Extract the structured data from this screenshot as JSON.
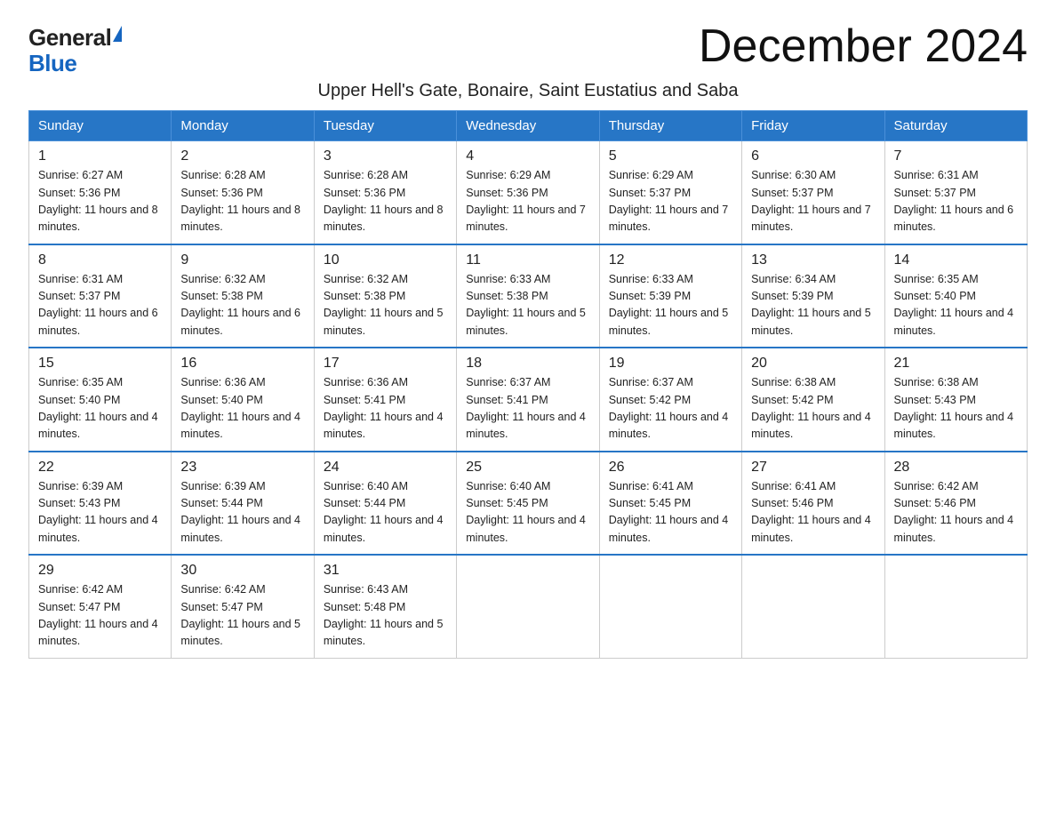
{
  "header": {
    "logo_general": "General",
    "logo_blue": "Blue",
    "month_title": "December 2024",
    "location": "Upper Hell's Gate, Bonaire, Saint Eustatius and Saba"
  },
  "days_of_week": [
    "Sunday",
    "Monday",
    "Tuesday",
    "Wednesday",
    "Thursday",
    "Friday",
    "Saturday"
  ],
  "weeks": [
    [
      {
        "day": "1",
        "sunrise": "6:27 AM",
        "sunset": "5:36 PM",
        "daylight": "11 hours and 8 minutes."
      },
      {
        "day": "2",
        "sunrise": "6:28 AM",
        "sunset": "5:36 PM",
        "daylight": "11 hours and 8 minutes."
      },
      {
        "day": "3",
        "sunrise": "6:28 AM",
        "sunset": "5:36 PM",
        "daylight": "11 hours and 8 minutes."
      },
      {
        "day": "4",
        "sunrise": "6:29 AM",
        "sunset": "5:36 PM",
        "daylight": "11 hours and 7 minutes."
      },
      {
        "day": "5",
        "sunrise": "6:29 AM",
        "sunset": "5:37 PM",
        "daylight": "11 hours and 7 minutes."
      },
      {
        "day": "6",
        "sunrise": "6:30 AM",
        "sunset": "5:37 PM",
        "daylight": "11 hours and 7 minutes."
      },
      {
        "day": "7",
        "sunrise": "6:31 AM",
        "sunset": "5:37 PM",
        "daylight": "11 hours and 6 minutes."
      }
    ],
    [
      {
        "day": "8",
        "sunrise": "6:31 AM",
        "sunset": "5:37 PM",
        "daylight": "11 hours and 6 minutes."
      },
      {
        "day": "9",
        "sunrise": "6:32 AM",
        "sunset": "5:38 PM",
        "daylight": "11 hours and 6 minutes."
      },
      {
        "day": "10",
        "sunrise": "6:32 AM",
        "sunset": "5:38 PM",
        "daylight": "11 hours and 5 minutes."
      },
      {
        "day": "11",
        "sunrise": "6:33 AM",
        "sunset": "5:38 PM",
        "daylight": "11 hours and 5 minutes."
      },
      {
        "day": "12",
        "sunrise": "6:33 AM",
        "sunset": "5:39 PM",
        "daylight": "11 hours and 5 minutes."
      },
      {
        "day": "13",
        "sunrise": "6:34 AM",
        "sunset": "5:39 PM",
        "daylight": "11 hours and 5 minutes."
      },
      {
        "day": "14",
        "sunrise": "6:35 AM",
        "sunset": "5:40 PM",
        "daylight": "11 hours and 4 minutes."
      }
    ],
    [
      {
        "day": "15",
        "sunrise": "6:35 AM",
        "sunset": "5:40 PM",
        "daylight": "11 hours and 4 minutes."
      },
      {
        "day": "16",
        "sunrise": "6:36 AM",
        "sunset": "5:40 PM",
        "daylight": "11 hours and 4 minutes."
      },
      {
        "day": "17",
        "sunrise": "6:36 AM",
        "sunset": "5:41 PM",
        "daylight": "11 hours and 4 minutes."
      },
      {
        "day": "18",
        "sunrise": "6:37 AM",
        "sunset": "5:41 PM",
        "daylight": "11 hours and 4 minutes."
      },
      {
        "day": "19",
        "sunrise": "6:37 AM",
        "sunset": "5:42 PM",
        "daylight": "11 hours and 4 minutes."
      },
      {
        "day": "20",
        "sunrise": "6:38 AM",
        "sunset": "5:42 PM",
        "daylight": "11 hours and 4 minutes."
      },
      {
        "day": "21",
        "sunrise": "6:38 AM",
        "sunset": "5:43 PM",
        "daylight": "11 hours and 4 minutes."
      }
    ],
    [
      {
        "day": "22",
        "sunrise": "6:39 AM",
        "sunset": "5:43 PM",
        "daylight": "11 hours and 4 minutes."
      },
      {
        "day": "23",
        "sunrise": "6:39 AM",
        "sunset": "5:44 PM",
        "daylight": "11 hours and 4 minutes."
      },
      {
        "day": "24",
        "sunrise": "6:40 AM",
        "sunset": "5:44 PM",
        "daylight": "11 hours and 4 minutes."
      },
      {
        "day": "25",
        "sunrise": "6:40 AM",
        "sunset": "5:45 PM",
        "daylight": "11 hours and 4 minutes."
      },
      {
        "day": "26",
        "sunrise": "6:41 AM",
        "sunset": "5:45 PM",
        "daylight": "11 hours and 4 minutes."
      },
      {
        "day": "27",
        "sunrise": "6:41 AM",
        "sunset": "5:46 PM",
        "daylight": "11 hours and 4 minutes."
      },
      {
        "day": "28",
        "sunrise": "6:42 AM",
        "sunset": "5:46 PM",
        "daylight": "11 hours and 4 minutes."
      }
    ],
    [
      {
        "day": "29",
        "sunrise": "6:42 AM",
        "sunset": "5:47 PM",
        "daylight": "11 hours and 4 minutes."
      },
      {
        "day": "30",
        "sunrise": "6:42 AM",
        "sunset": "5:47 PM",
        "daylight": "11 hours and 5 minutes."
      },
      {
        "day": "31",
        "sunrise": "6:43 AM",
        "sunset": "5:48 PM",
        "daylight": "11 hours and 5 minutes."
      },
      null,
      null,
      null,
      null
    ]
  ]
}
